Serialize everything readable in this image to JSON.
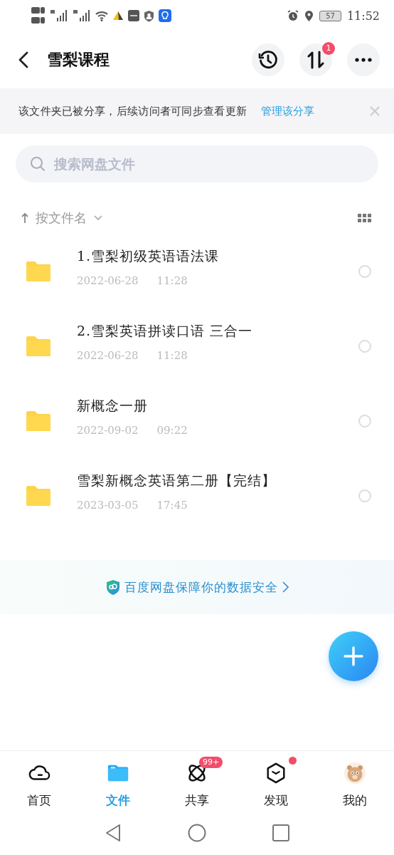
{
  "status_bar": {
    "time": "11:52",
    "battery": "57"
  },
  "header": {
    "title": "雪梨课程",
    "transfer_badge": "1"
  },
  "share_banner": {
    "text": "该文件夹已被分享，后续访问者可同步查看更新",
    "link": "管理该分享"
  },
  "search": {
    "placeholder": "搜索网盘文件"
  },
  "sort": {
    "label": "按文件名"
  },
  "files": [
    {
      "name": "1.雪梨初级英语语法课",
      "date": "2022-06-28",
      "time": "11:28",
      "selected": false
    },
    {
      "name": "2.雪梨英语拼读口语 三合一",
      "date": "2022-06-28",
      "time": "11:28",
      "selected": false
    },
    {
      "name": "新概念一册",
      "date": "2022-09-02",
      "time": "09:22",
      "selected": false
    },
    {
      "name": "雪梨新概念英语第二册【完结】",
      "date": "2023-03-05",
      "time": "17:45",
      "selected": false
    }
  ],
  "security_note": "百度网盘保障你的数据安全",
  "tabs": [
    {
      "label": "首页",
      "kind": "cloud",
      "selected": false
    },
    {
      "label": "文件",
      "kind": "folder",
      "selected": true
    },
    {
      "label": "共享",
      "kind": "atom",
      "selected": false,
      "badge": "99+"
    },
    {
      "label": "发现",
      "kind": "cube",
      "selected": false,
      "dot": true
    },
    {
      "label": "我的",
      "kind": "avatar",
      "selected": false
    }
  ]
}
